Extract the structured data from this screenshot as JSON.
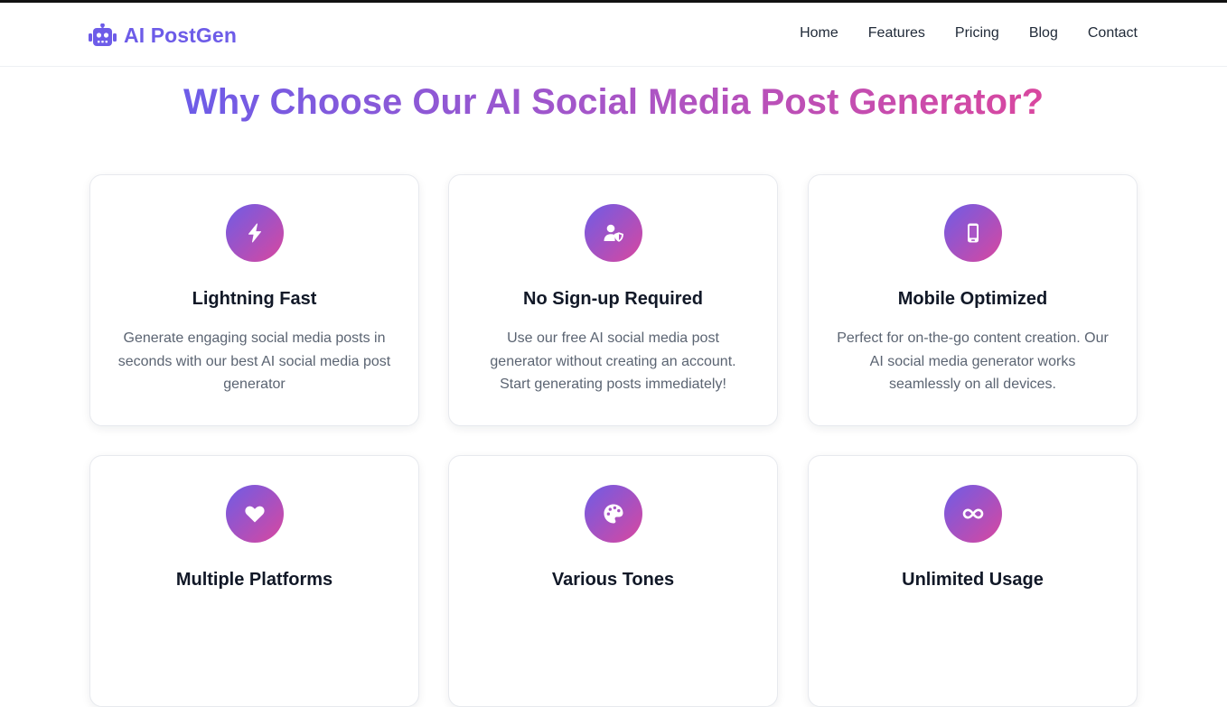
{
  "header": {
    "brand": "AI PostGen",
    "nav": [
      "Home",
      "Features",
      "Pricing",
      "Blog",
      "Contact"
    ]
  },
  "section": {
    "title": "Why Choose Our AI Social Media Post Generator?"
  },
  "features": [
    {
      "icon": "lightning-bolt-icon",
      "title": "Lightning Fast",
      "description": "Generate engaging social media posts in seconds with our best AI social media post generator"
    },
    {
      "icon": "user-shield-icon",
      "title": "No Sign-up Required",
      "description": "Use our free AI social media post generator without creating an account. Start generating posts immediately!"
    },
    {
      "icon": "mobile-phone-icon",
      "title": "Mobile Optimized",
      "description": "Perfect for on-the-go content creation. Our AI social media generator works seamlessly on all devices."
    },
    {
      "icon": "heart-icon",
      "title": "Multiple Platforms",
      "description": ""
    },
    {
      "icon": "palette-icon",
      "title": "Various Tones",
      "description": ""
    },
    {
      "icon": "infinity-icon",
      "title": "Unlimited Usage",
      "description": ""
    }
  ],
  "colors": {
    "brand": "#6d5ce8",
    "gradient_start": "#6e5ce6",
    "gradient_end": "#d9479f",
    "text_dark": "#111827",
    "text_muted": "#5b6472"
  }
}
